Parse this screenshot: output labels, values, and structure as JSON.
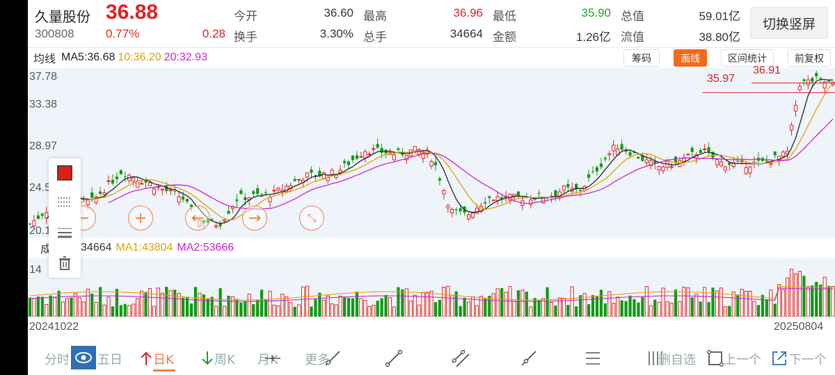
{
  "header": {
    "stock_name": "久量股份",
    "price": "36.88",
    "code": "300808",
    "pct_change": "0.77%",
    "change": "0.28",
    "stats": [
      {
        "label": "今开",
        "value": "36.60",
        "color": "#333333"
      },
      {
        "label": "最高",
        "value": "36.96",
        "color": "#e02020"
      },
      {
        "label": "最低",
        "value": "35.90",
        "color": "#22a022"
      },
      {
        "label": "总值",
        "value": "59.01亿",
        "color": "#333333"
      },
      {
        "label": "换手",
        "value": "3.30%",
        "color": "#333333"
      },
      {
        "label": "总手",
        "value": "34664",
        "color": "#333333"
      },
      {
        "label": "金额",
        "value": "1.26亿",
        "color": "#333333"
      },
      {
        "label": "流值",
        "value": "38.80亿",
        "color": "#333333"
      }
    ],
    "switch_button": "切换竖屏"
  },
  "indicators": {
    "label": "均线",
    "ma5": "MA5:36.68",
    "ma10": "10:36.20",
    "ma20": "20:32.93"
  },
  "tools": {
    "chips": "筹码",
    "draw": "画线",
    "interval": "区间统计",
    "adjust": "前复权"
  },
  "price_axis": {
    "labels": [
      "37.78",
      "33.38",
      "28.97",
      "24.5",
      "20.1"
    ],
    "annotation_low": "35.97",
    "annotation_high": "36.91"
  },
  "volume": {
    "label": "成交量",
    "value": "34664",
    "ma1": "MA1:43804",
    "ma2": "MA2:53666",
    "axis_label": "14"
  },
  "dates": {
    "start": "20241022",
    "end": "20250804"
  },
  "bottom_bar": {
    "fenshi": "分时",
    "wuri": "五日",
    "rik": "日K",
    "zhouk": "周K",
    "yuek": "月K",
    "more": "更多",
    "add_watch": "删自选",
    "prev": "上一个",
    "next": "下一个"
  },
  "colors": {
    "up": "#e02020",
    "down": "#109a10",
    "ma5": "#222222",
    "ma10": "#e0a000",
    "ma20": "#cc22cc",
    "accent": "#f26a1b"
  }
}
